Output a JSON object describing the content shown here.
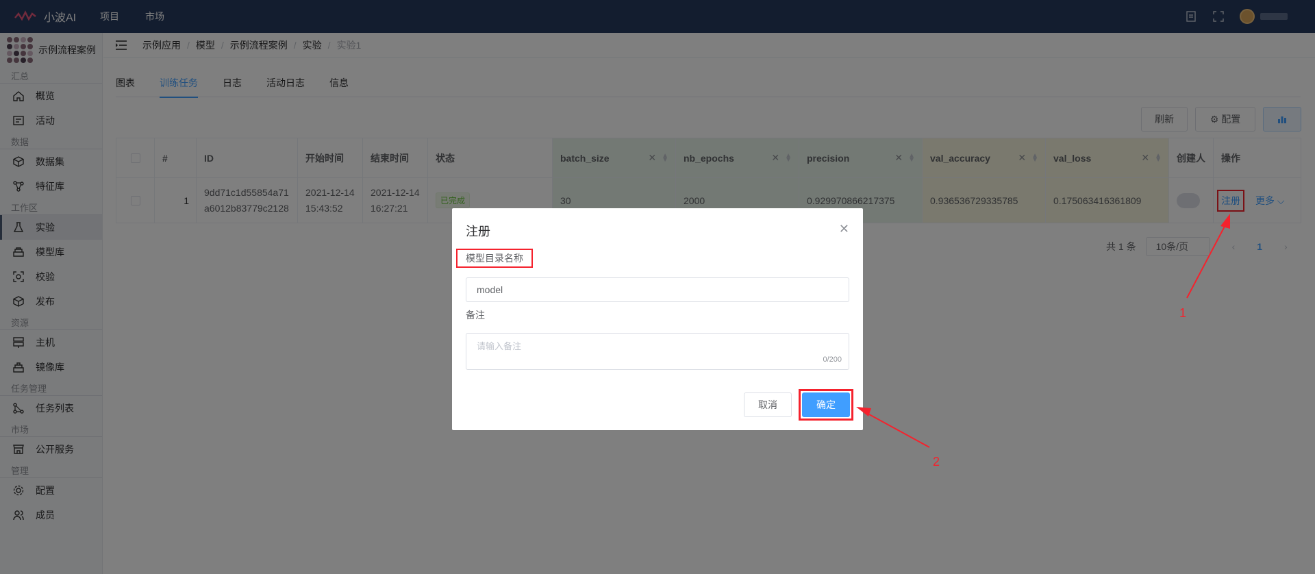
{
  "app": {
    "name": "小波AI",
    "nav": [
      "项目",
      "市场"
    ]
  },
  "sidebar": {
    "project": "示例流程案例",
    "sections": [
      {
        "title": "汇总",
        "items": [
          {
            "label": "概览",
            "icon": "home-icon"
          },
          {
            "label": "活动",
            "icon": "activity-icon"
          }
        ]
      },
      {
        "title": "数据",
        "items": [
          {
            "label": "数据集",
            "icon": "cube-icon"
          },
          {
            "label": "特征库",
            "icon": "network-icon"
          }
        ]
      },
      {
        "title": "工作区",
        "items": [
          {
            "label": "实验",
            "icon": "flask-icon"
          },
          {
            "label": "模型库",
            "icon": "layers-icon"
          },
          {
            "label": "校验",
            "icon": "scan-icon"
          },
          {
            "label": "发布",
            "icon": "box-icon"
          }
        ]
      },
      {
        "title": "资源",
        "items": [
          {
            "label": "主机",
            "icon": "server-icon"
          },
          {
            "label": "镜像库",
            "icon": "stack-icon"
          }
        ]
      },
      {
        "title": "任务管理",
        "items": [
          {
            "label": "任务列表",
            "icon": "flow-icon"
          }
        ]
      },
      {
        "title": "市场",
        "items": [
          {
            "label": "公开服务",
            "icon": "store-icon"
          }
        ]
      },
      {
        "title": "管理",
        "items": [
          {
            "label": "配置",
            "icon": "gear-icon"
          },
          {
            "label": "成员",
            "icon": "users-icon"
          }
        ]
      }
    ]
  },
  "breadcrumb": [
    "示例应用",
    "模型",
    "示例流程案例",
    "实验",
    "实验1"
  ],
  "tabs": [
    "图表",
    "训练任务",
    "日志",
    "活动日志",
    "信息"
  ],
  "toolbar": {
    "refresh": "刷新",
    "config": "配置"
  },
  "table": {
    "headers": [
      "#",
      "ID",
      "开始时间",
      "结束时间",
      "状态",
      "batch_size",
      "nb_epochs",
      "precision",
      "val_accuracy",
      "val_loss",
      "创建人",
      "操作"
    ],
    "row": {
      "index": "1",
      "id_line1": "9dd71c1d55854a71",
      "id_line2": "a6012b83779c2128",
      "start_date": "2021-12-14",
      "start_time": "15:43:52",
      "end_date": "2021-12-14",
      "end_time": "16:27:21",
      "status": "已完成",
      "batch_size": "30",
      "nb_epochs": "2000",
      "precision": "0.929970866217375",
      "val_accuracy": "0.936536729335785",
      "val_loss": "0.175063416361809",
      "op_register": "注册",
      "op_more": "更多"
    }
  },
  "pager": {
    "total": "共 1 条",
    "size": "10条/页",
    "page": "1"
  },
  "dialog": {
    "title": "注册",
    "field1_label": "模型目录名称",
    "field1_value": "model",
    "field2_label": "备注",
    "field2_placeholder": "请输入备注",
    "counter": "0/200",
    "cancel": "取消",
    "ok": "确定"
  },
  "annotations": {
    "step1": "1",
    "step2": "2"
  },
  "colors": {
    "topbar": "#273a5e",
    "accent": "#409eff",
    "highlight": "#f5222d"
  }
}
